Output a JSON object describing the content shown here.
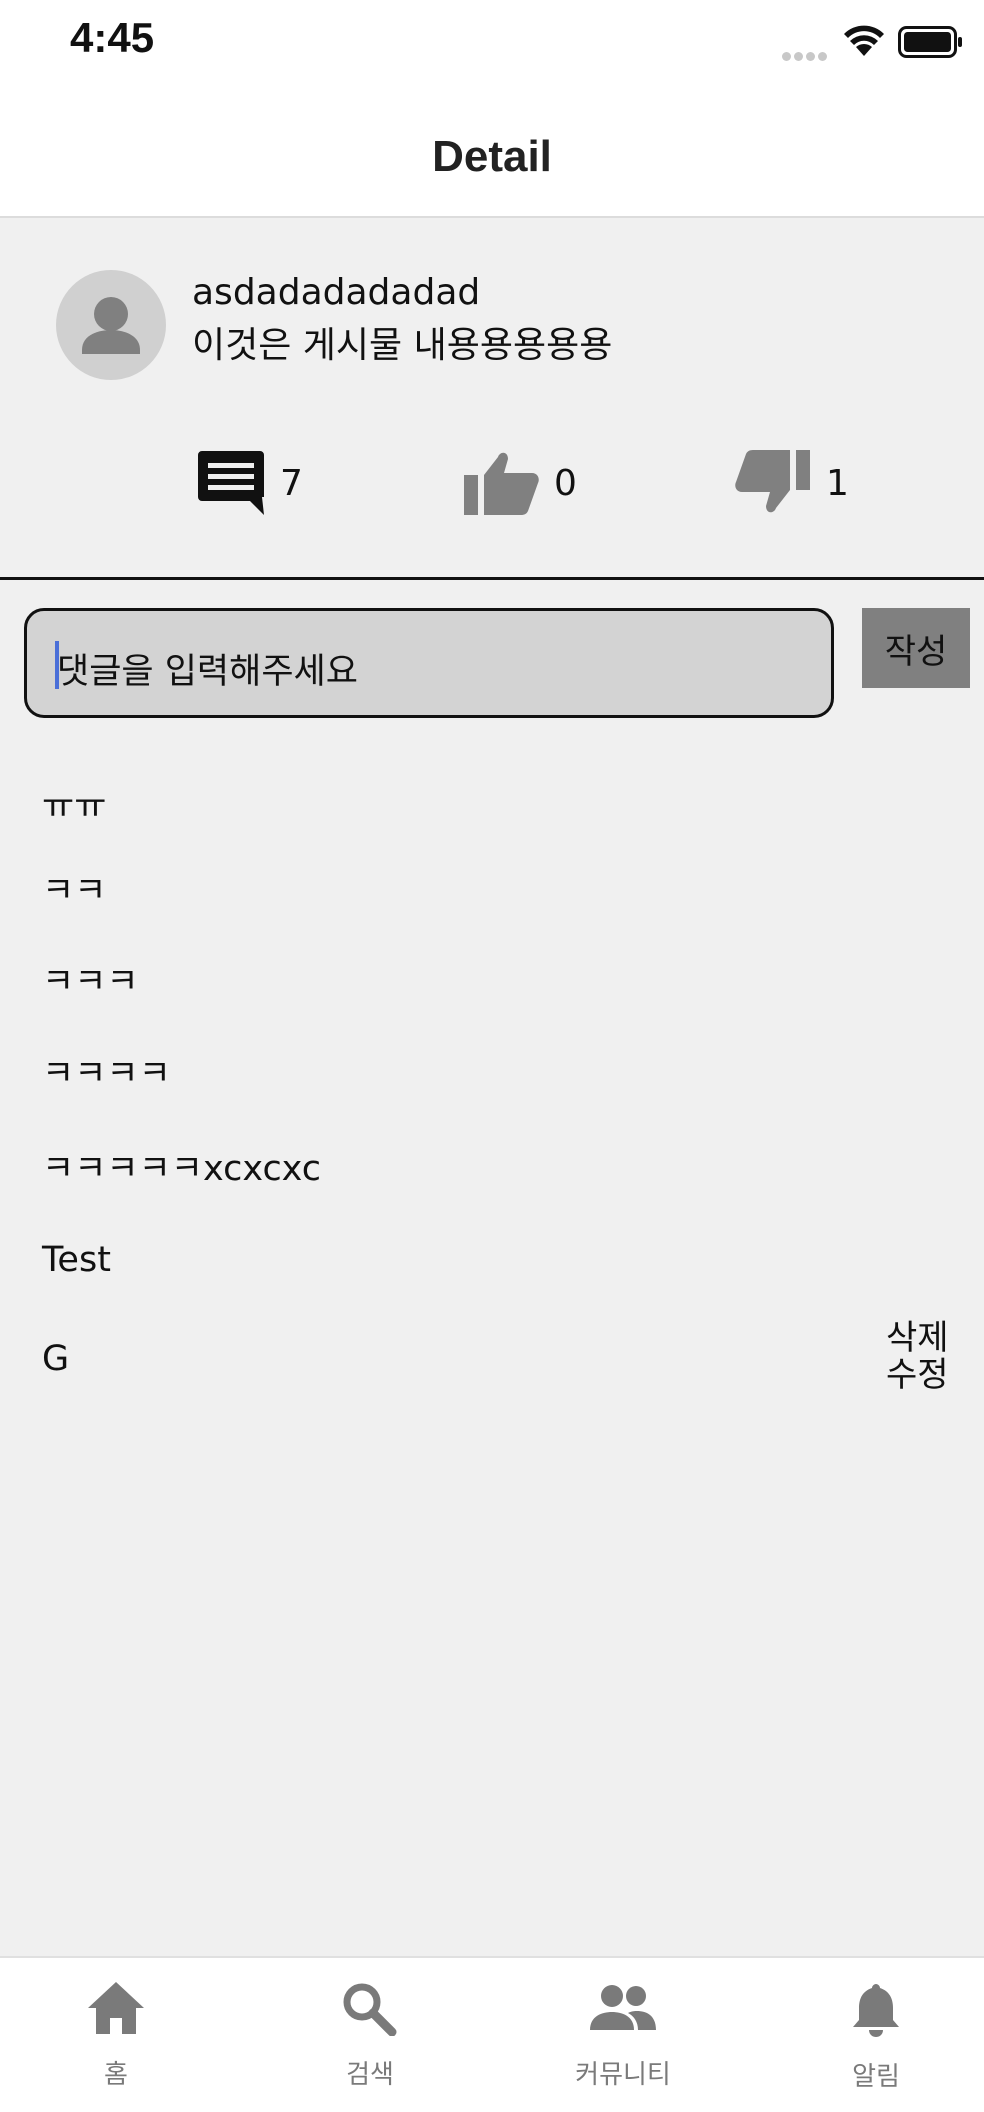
{
  "status_bar": {
    "time": "4:45"
  },
  "header": {
    "title": "Detail"
  },
  "post": {
    "author": "asdadadadadad",
    "content": "이것은 게시물 내용용용용용",
    "comment_count": "7",
    "like_count": "0",
    "dislike_count": "1"
  },
  "comment_form": {
    "placeholder": "댓글을 입력해주세요",
    "submit_label": "작성"
  },
  "comments": [
    "ㅠㅠ",
    "ㅋㅋ",
    "ㅋㅋㅋ",
    "ㅋㅋㅋㅋ",
    "ㅋㅋㅋㅋㅋxcxcxc",
    "Test",
    "G"
  ],
  "comment_actions": {
    "delete_label": "삭제",
    "edit_label": "수정"
  },
  "tab_bar": {
    "items": [
      {
        "label": "홈",
        "icon": "home-icon"
      },
      {
        "label": "검색",
        "icon": "search-icon"
      },
      {
        "label": "커뮤니티",
        "icon": "people-icon"
      },
      {
        "label": "알림",
        "icon": "bell-icon"
      }
    ]
  },
  "colors": {
    "background": "#f0f0f0",
    "input_fill": "#d3d3d3",
    "button_fill": "#808080",
    "icon_gray": "#7a7a7a",
    "caret": "#4a6fd8"
  }
}
